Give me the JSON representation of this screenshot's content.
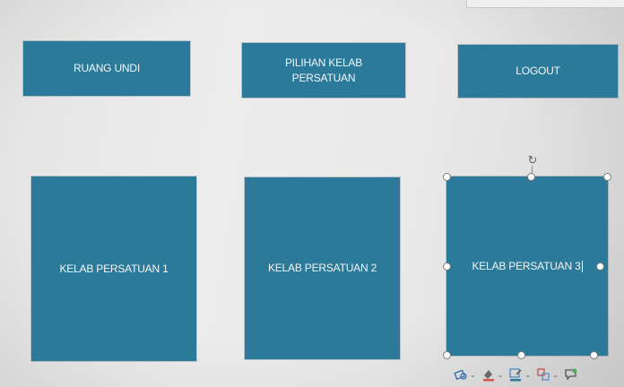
{
  "nav_buttons": {
    "ruang_undi": "RUANG UNDI",
    "pilihan_kelab": "PILIHAN KELAB\nPERSATUAN",
    "logout": "LOGOUT"
  },
  "club_cards": {
    "club_1": "KELAB PERSATUAN 1",
    "club_2": "KELAB PERSATUAN 2",
    "club_3": "KELAB PERSATUAN 3"
  },
  "colors": {
    "tile": "#2b7a9a",
    "tile_text": "#f2f6f8",
    "background": "#ebebeb"
  },
  "toolbar": {
    "icons": [
      "shape-style-icon",
      "shape-fill-icon",
      "shape-outline-icon",
      "arrange-icon",
      "comment-icon"
    ],
    "chevron": "⌄"
  },
  "selection": {
    "selected_item": "club_3",
    "text_editing": true
  }
}
